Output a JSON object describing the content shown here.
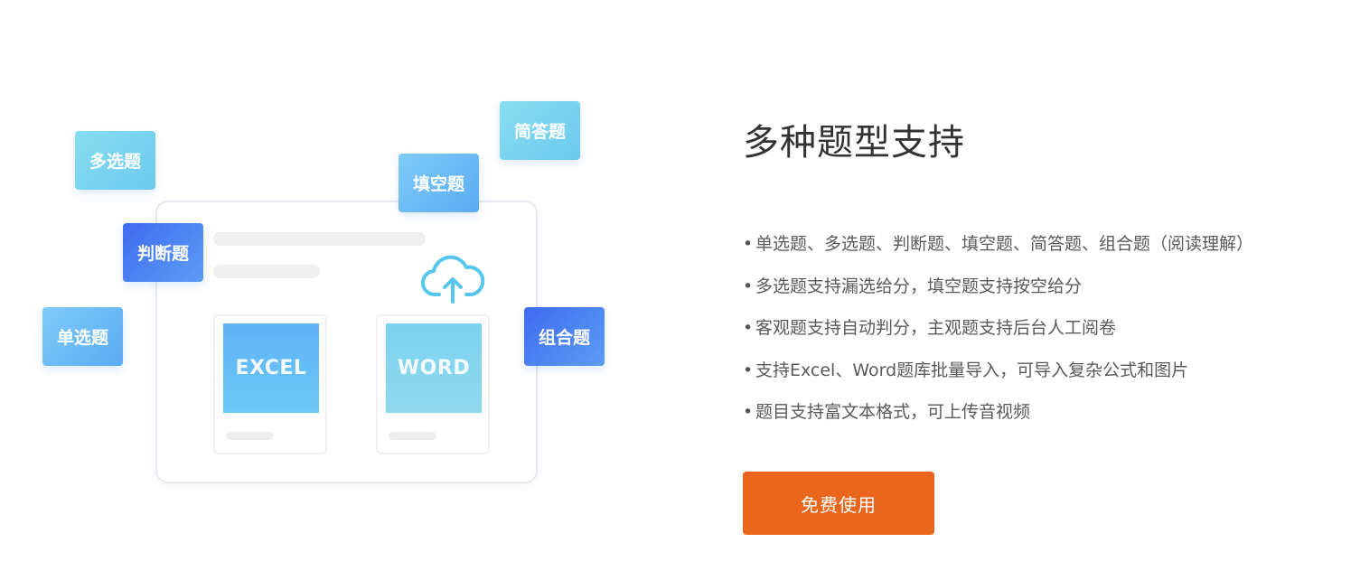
{
  "illustration": {
    "files": [
      {
        "label": "EXCEL"
      },
      {
        "label": "WORD"
      }
    ],
    "tags": {
      "multi_choice": "多选题",
      "true_false": "判断题",
      "single_choice": "单选题",
      "fill_blank": "填空题",
      "short_answer": "简答题",
      "combination": "组合题"
    },
    "upload_icon": "cloud-upload-icon"
  },
  "content": {
    "title": "多种题型支持",
    "features": [
      "单选题、多选题、判断题、填空题、简答题、组合题（阅读理解）",
      "多选题支持漏选给分，填空题支持按空给分",
      "客观题支持自动判分，主观题支持后台人工阅卷",
      "支持Excel、Word题库批量导入，可导入复杂公式和图片",
      "题目支持富文本格式，可上传音视频"
    ],
    "bullet": "•",
    "cta_label": "免费使用"
  },
  "colors": {
    "cta": "#ea661c",
    "tag_cyan": "#7dd3f0",
    "tag_sky": "#6bbaf5",
    "tag_blue": "#4a7ff2",
    "title_text": "#333333",
    "feature_text": "#5a5a5a"
  }
}
